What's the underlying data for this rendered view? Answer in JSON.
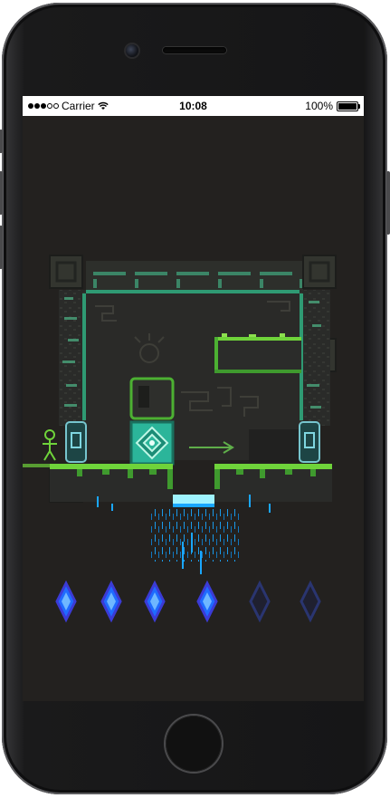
{
  "status_bar": {
    "carrier": "Carrier",
    "time": "10:08",
    "battery": "100%",
    "signal_dots_filled": 3,
    "signal_dots_total": 5
  },
  "level": {
    "arrow_direction": "right",
    "player": "stick-figure",
    "block": "pushable-crate"
  },
  "gems": [
    {
      "state": "collected",
      "color": "#1f6bff"
    },
    {
      "state": "collected",
      "color": "#1f6bff"
    },
    {
      "state": "collected",
      "color": "#1f6bff"
    },
    {
      "state": "collected",
      "color": "#1f6bff"
    },
    {
      "state": "empty",
      "color": "#2a3570"
    },
    {
      "state": "empty",
      "color": "#2a3570"
    }
  ],
  "colors": {
    "background": "#23211f",
    "grass": "#6fd33a",
    "crate": "#2bb59a",
    "water": "#1aa7ff",
    "stone_dark": "#2c2d2b"
  }
}
